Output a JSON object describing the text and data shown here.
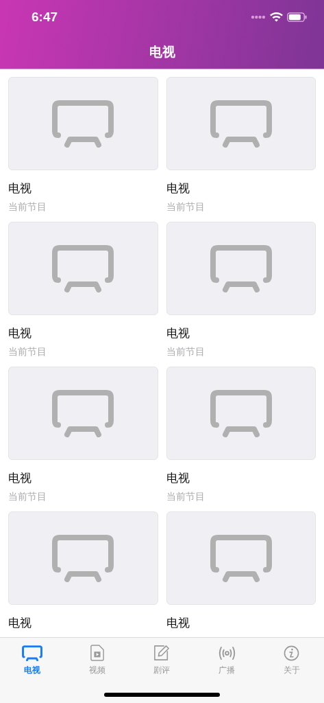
{
  "status_bar": {
    "time": "6:47"
  },
  "nav_bar": {
    "title": "电视"
  },
  "cards": [
    {
      "kind": "picture",
      "title": "电视",
      "subtitle": "当前节目"
    },
    {
      "kind": "picture",
      "title": "电视",
      "subtitle": "当前节目"
    },
    {
      "kind": "picture",
      "title": "电视",
      "subtitle": "当前节目"
    },
    {
      "kind": "picture",
      "title": "电视",
      "subtitle": "当前节目"
    },
    {
      "kind": "picture",
      "title": "电视",
      "subtitle": "当前节目"
    },
    {
      "kind": "picture",
      "title": "电视",
      "subtitle": "当前节目"
    },
    {
      "kind": "picture",
      "title": "电视"
    },
    {
      "kind": "picture",
      "title": "电视"
    }
  ],
  "tab_bar": [
    {
      "label": "电视",
      "kind": "tv",
      "selected": true
    },
    {
      "label": "视频",
      "kind": "video",
      "selected": false
    },
    {
      "label": "剧评",
      "kind": "edit",
      "selected": false
    },
    {
      "label": "广播",
      "kind": "radio",
      "selected": false
    },
    {
      "label": "关于",
      "kind": "info",
      "selected": false
    }
  ]
}
